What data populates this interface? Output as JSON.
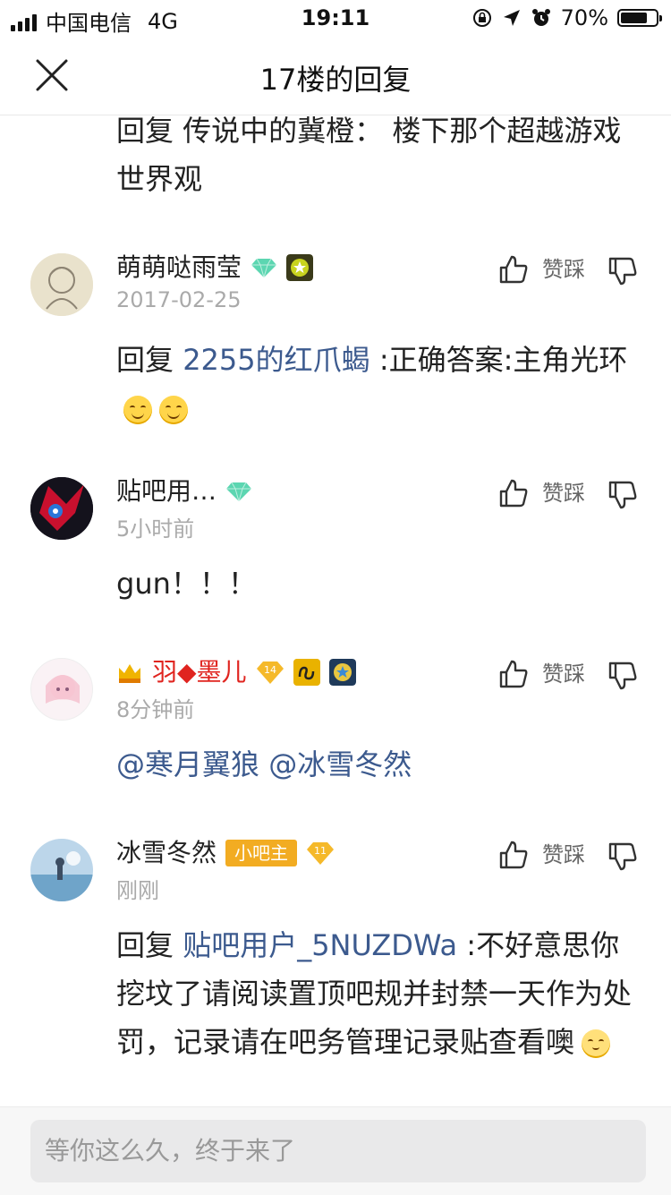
{
  "status_bar": {
    "carrier": "中国电信",
    "network": "4G",
    "time": "19:11",
    "battery": "70%"
  },
  "header": {
    "title": "17楼的回复"
  },
  "previous_reply": {
    "text": "回复 传说中的冀橙： 楼下那个超越游戏世界观"
  },
  "replies": [
    {
      "username": "萌萌哒雨莹",
      "level_gem": "1",
      "time": "2017-02-25",
      "prefix": "回复 ",
      "mention": "2255的红爪蝎",
      "text": " :正确答案:主角光环",
      "emoji": [
        "smile",
        "smile"
      ],
      "action_label": "赞踩"
    },
    {
      "username": "贴吧用…",
      "level_gem": "1",
      "time": "5小时前",
      "text": "gun！！！",
      "action_label": "赞踩"
    },
    {
      "username": "羽◆墨儿",
      "level_badge": "14",
      "time": "8分钟前",
      "mention_1": "@寒月翼狼",
      "mention_2": "@冰雪冬然",
      "action_label": "赞踩"
    },
    {
      "username": "冰雪冬然",
      "role_badge": "小吧主",
      "level_badge": "11",
      "time": "刚刚",
      "prefix": "回复 ",
      "mention": "贴吧用户_5NUZDWa",
      "text": " :不好意思你挖坟了请阅读置顶吧规并封禁一天作为处罚，记录请在吧务管理记录贴查看噢",
      "action_label": "赞踩"
    }
  ],
  "input": {
    "placeholder": "等你这么久，终于来了"
  },
  "colors": {
    "link": "#3c5a8e",
    "username_red": "#e0241f",
    "badge_orange": "#f2ac22"
  }
}
